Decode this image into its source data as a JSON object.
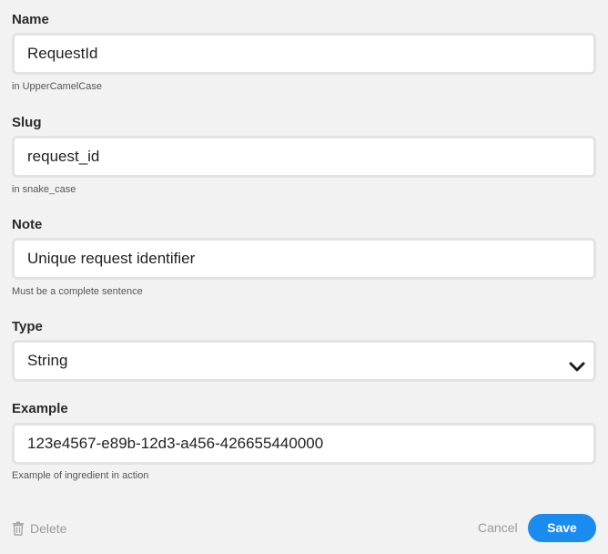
{
  "fields": {
    "name": {
      "label": "Name",
      "value": "RequestId",
      "hint": "in UpperCamelCase"
    },
    "slug": {
      "label": "Slug",
      "value": "request_id",
      "hint": "in snake_case"
    },
    "note": {
      "label": "Note",
      "value": "Unique request identifier",
      "hint": "Must be a complete sentence"
    },
    "type": {
      "label": "Type",
      "selected": "String"
    },
    "example": {
      "label": "Example",
      "value": "123e4567-e89b-12d3-a456-426655440000",
      "hint": "Example of ingredient in action"
    }
  },
  "actions": {
    "delete_label": "Delete",
    "cancel_label": "Cancel",
    "save_label": "Save"
  },
  "icons": {
    "delete": "trash-icon",
    "type_dropdown": "chevron-down-icon"
  },
  "colors": {
    "background": "#f2f2f2",
    "accent": "#1a8cf0",
    "muted_text": "#9a9a9a",
    "input_border": "#e3e3e3"
  }
}
